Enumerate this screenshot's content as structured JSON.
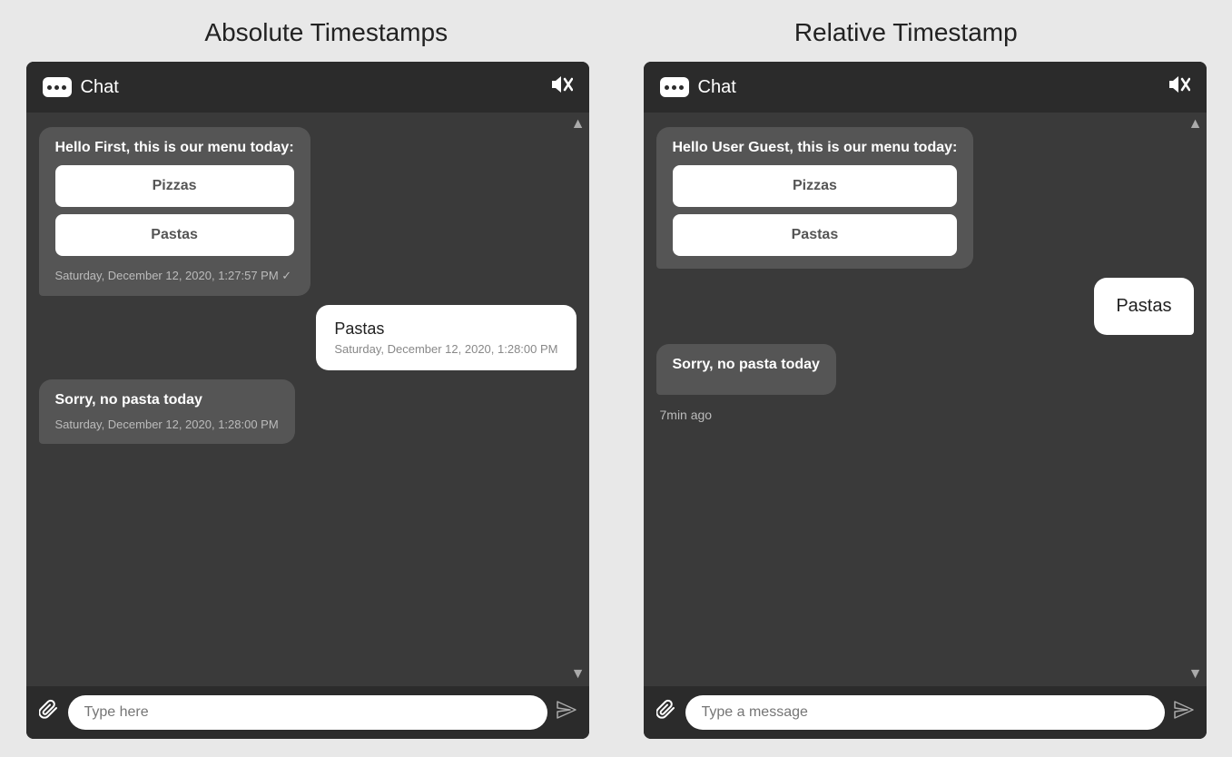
{
  "left_panel": {
    "section_title": "Absolute Timestamps",
    "header": {
      "title": "Chat"
    },
    "messages": [
      {
        "type": "bot",
        "text": "Hello First, this is our menu today:",
        "buttons": [
          "Pizzas",
          "Pastas"
        ],
        "timestamp": "Saturday, December 12, 2020, 1:27:57 PM ✓"
      },
      {
        "type": "user",
        "text": "Pastas",
        "timestamp": "Saturday, December 12, 2020, 1:28:00 PM"
      },
      {
        "type": "bot_simple",
        "text": "Sorry, no pasta today",
        "timestamp": "Saturday, December 12, 2020, 1:28:00 PM"
      }
    ],
    "input": {
      "placeholder": "Type here"
    }
  },
  "right_panel": {
    "section_title": "Relative Timestamp",
    "header": {
      "title": "Chat"
    },
    "messages": [
      {
        "type": "bot",
        "text": "Hello User Guest, this is our menu today:",
        "buttons": [
          "Pizzas",
          "Pastas"
        ]
      },
      {
        "type": "user",
        "text": "Pastas"
      },
      {
        "type": "bot_simple",
        "text": "Sorry, no pasta today",
        "relative_timestamp": "7min ago"
      }
    ],
    "input": {
      "placeholder": "Type a message"
    }
  },
  "icons": {
    "mute": "🔇",
    "attach": "📎",
    "send": "➤"
  }
}
